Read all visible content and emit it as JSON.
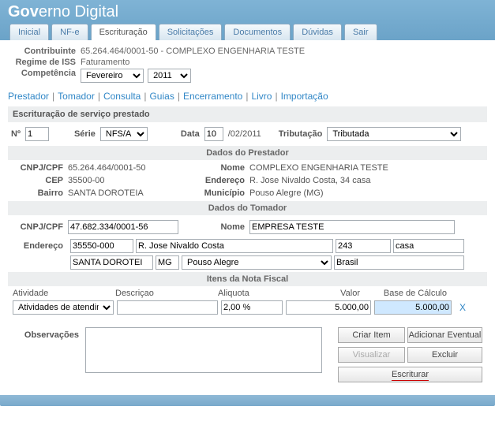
{
  "brand": {
    "bold": "Gov",
    "rest": "erno Digital"
  },
  "tabs": [
    "Inicial",
    "NF-e",
    "Escrituração",
    "Solicitações",
    "Documentos",
    "Dúvidas",
    "Sair"
  ],
  "active_tab_index": 2,
  "info": {
    "contribuinte_label": "Contribuinte",
    "contribuinte": "65.264.464/0001-50 - COMPLEXO ENGENHARIA TESTE",
    "regime_label": "Regime de ISS",
    "regime": "Faturamento",
    "competencia_label": "Competência",
    "mes": "Fevereiro",
    "ano": "2011"
  },
  "subnav": [
    "Prestador",
    "Tomador",
    "Consulta",
    "Guias",
    "Encerramento",
    "Livro",
    "Importação"
  ],
  "section_title": "Escrituração de serviço prestado",
  "main": {
    "n_label": "Nº",
    "n": "1",
    "serie_label": "Série",
    "serie": "NFS/A",
    "data_label": "Data",
    "data_dia": "10",
    "data_rest": "/02/2011",
    "tributacao_label": "Tributação",
    "tributacao": "Tributada"
  },
  "prestador": {
    "title": "Dados do Prestador",
    "cnpj_label": "CNPJ/CPF",
    "cnpj": "65.264.464/0001-50",
    "nome_label": "Nome",
    "nome": "COMPLEXO ENGENHARIA TESTE",
    "cep_label": "CEP",
    "cep": "35500-00",
    "endereco_label": "Endereço",
    "endereco": "R. Jose Nivaldo Costa, 34 casa",
    "bairro_label": "Bairro",
    "bairro": "SANTA DOROTEIA",
    "municipio_label": "Município",
    "municipio": "Pouso Alegre (MG)"
  },
  "tomador": {
    "title": "Dados do Tomador",
    "cnpj_label": "CNPJ/CPF",
    "cnpj": "47.682.334/0001-56",
    "nome_label": "Nome",
    "nome": "EMPRESA TESTE",
    "endereco_label": "Endereço",
    "cep": "35550-000",
    "rua": "R. Jose Nivaldo Costa",
    "num": "243",
    "compl": "casa",
    "bairro": "SANTA DOROTEI",
    "uf": "MG",
    "cidade": "Pouso Alegre",
    "pais": "Brasil"
  },
  "itens": {
    "title": "Itens da Nota Fiscal",
    "headers": {
      "atividade": "Atividade",
      "descricao": "Descriçao",
      "aliquota": "Aliquota",
      "valor": "Valor",
      "base": "Base de Cálculo"
    },
    "row": {
      "atividade": "Atividades de atendimento",
      "descricao": "",
      "aliquota": "2,00 %",
      "valor": "5.000,00",
      "base": "5.000,00"
    },
    "delete_symbol": "X"
  },
  "obs": {
    "label": "Observações",
    "value": ""
  },
  "buttons": {
    "criar": "Criar Item",
    "adicionar": "Adicionar Eventual",
    "visualizar": "Visualizar",
    "excluir": "Excluir",
    "escriturar": "Escriturar"
  }
}
